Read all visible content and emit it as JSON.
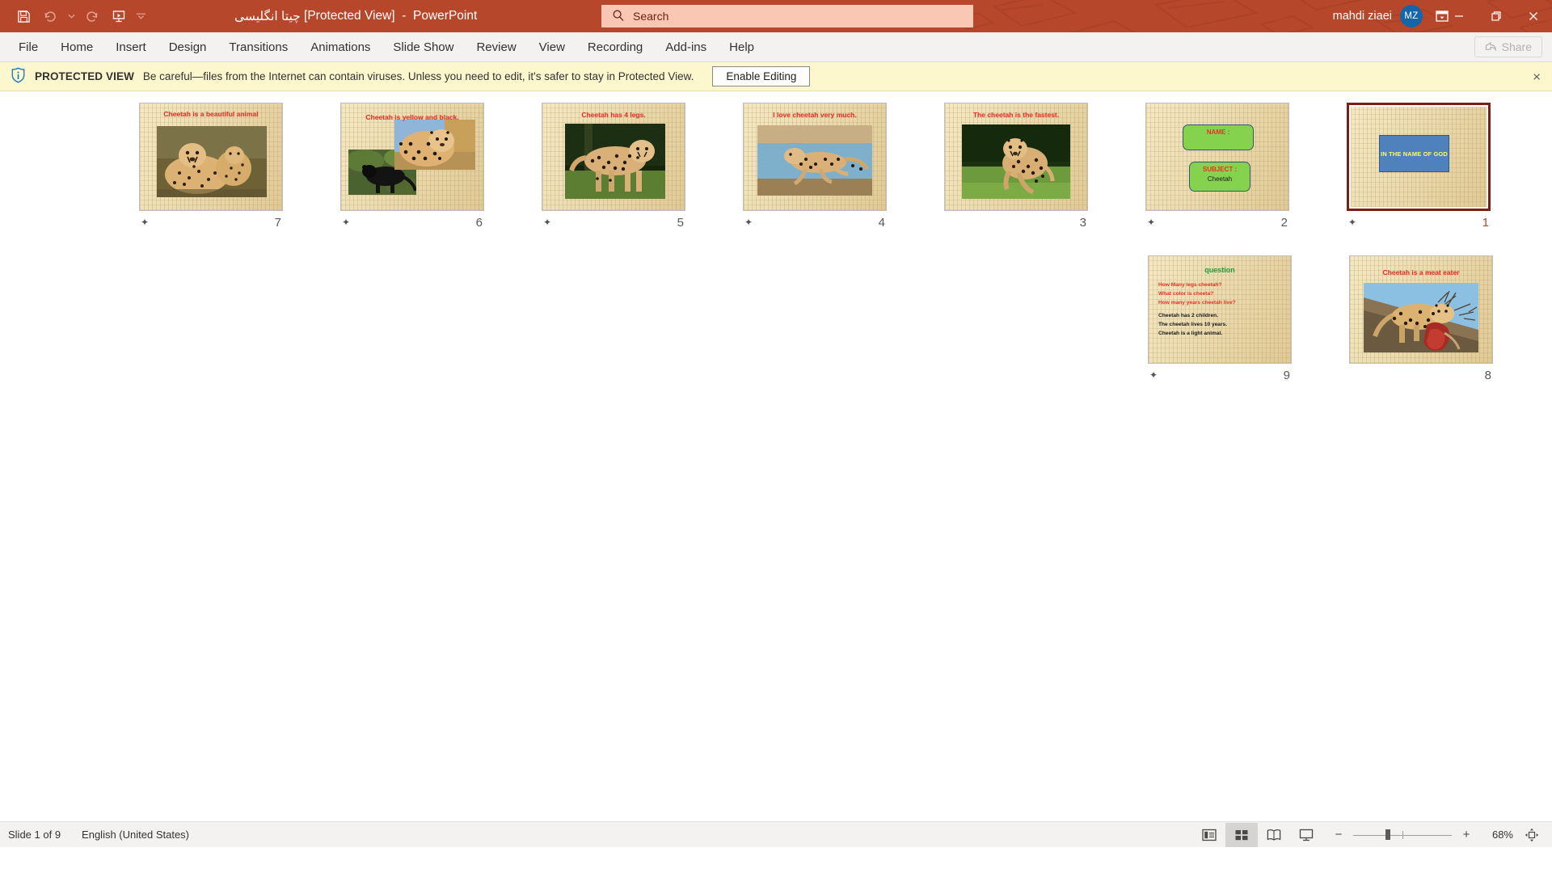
{
  "titlebar": {
    "quick_access": [
      {
        "name": "save-icon",
        "label": "Save"
      },
      {
        "name": "undo-icon",
        "label": "Undo"
      },
      {
        "name": "undo-dropdown-icon",
        "label": "Undo options"
      },
      {
        "name": "redo-icon",
        "label": "Redo"
      },
      {
        "name": "start-from-beginning-icon",
        "label": "Start From Beginning"
      },
      {
        "name": "customize-quick-access-toolbar-icon",
        "label": "Customize Quick Access Toolbar"
      }
    ],
    "document_name": "چیتا انگلیسی",
    "protected_tag": "[Protected View]",
    "separator": "-",
    "app_name": "PowerPoint",
    "search_placeholder": "Search",
    "account_name": "mahdi ziaei",
    "account_initials": "MZ",
    "ribbon_display_options": "Ribbon Display Options",
    "minimize": "Minimize",
    "restore": "Restore Down",
    "close": "Close",
    "accent_color": "#b7472a",
    "search_bg": "#f9c7b3",
    "avatar_color": "#1565a8"
  },
  "ribbon": {
    "tabs": [
      "File",
      "Home",
      "Insert",
      "Design",
      "Transitions",
      "Animations",
      "Slide Show",
      "Review",
      "View",
      "Recording",
      "Add-ins",
      "Help"
    ],
    "share_label": "Share"
  },
  "protected_view": {
    "icon": "info-shield-icon",
    "title": "PROTECTED VIEW",
    "message": "Be careful—files from the Internet can contain viruses. Unless you need to edit, it's safer to stay in Protected View.",
    "enable_button": "Enable Editing",
    "close_label": "×",
    "bg_color": "#fdf7cd"
  },
  "slides": [
    {
      "number": "7",
      "title": "Cheetah is a beautiful animal",
      "has_star": true,
      "selected": false,
      "image": "cheetah-adult-and-cub-in-savanna"
    },
    {
      "number": "6",
      "title": "Cheetah is yellow and black.",
      "has_star": true,
      "selected": false,
      "image": "black-panther-and-leopard-pair"
    },
    {
      "number": "5",
      "title": "Cheetah has 4 legs.",
      "has_star": true,
      "selected": false,
      "image": "cheetah-walking-on-grass"
    },
    {
      "number": "4",
      "title": "I love cheetah very much.",
      "has_star": true,
      "selected": false,
      "image": "cheetah-running-by-water"
    },
    {
      "number": "3",
      "title": "The cheetah is the fastest.",
      "has_star": false,
      "selected": false,
      "image": "cheetah-leaping-on-green-grass"
    },
    {
      "number": "2",
      "title": "",
      "has_star": true,
      "selected": false,
      "image": "",
      "boxes": [
        {
          "heading": "NAME :",
          "body": ""
        },
        {
          "heading": "SUBJECT :",
          "body": "Cheetah"
        }
      ]
    },
    {
      "number": "1",
      "title": "",
      "has_star": true,
      "selected": true,
      "image": "",
      "banner": "IN THE NAME OF GOD"
    },
    {
      "number": "9",
      "title": "question",
      "has_star": true,
      "selected": false,
      "image": "",
      "questions": [
        "How Many legs cheetah?",
        "What color is cheeta?",
        "How many years cheetah live?"
      ],
      "answers": [
        "Cheetah has 2 children.",
        "The cheetah lives 10 years.",
        "Cheetah is a light animal."
      ]
    },
    {
      "number": "8",
      "title": "Cheetah is a meat eater",
      "has_star": false,
      "selected": false,
      "image": "leopard-with-prey-in-tree"
    }
  ],
  "statusbar": {
    "slide_indicator": "Slide 1 of 9",
    "language": "English (United States)",
    "views": [
      {
        "name": "normal-view-icon",
        "label": "Normal",
        "active": false
      },
      {
        "name": "slide-sorter-view-icon",
        "label": "Slide Sorter",
        "active": true
      },
      {
        "name": "reading-view-icon",
        "label": "Reading View",
        "active": false
      },
      {
        "name": "slide-show-view-icon",
        "label": "Slide Show",
        "active": false
      }
    ],
    "zoom_out": "−",
    "zoom_in": "+",
    "zoom_value": "68%",
    "fit_to_window": "Fit slide to current window"
  }
}
